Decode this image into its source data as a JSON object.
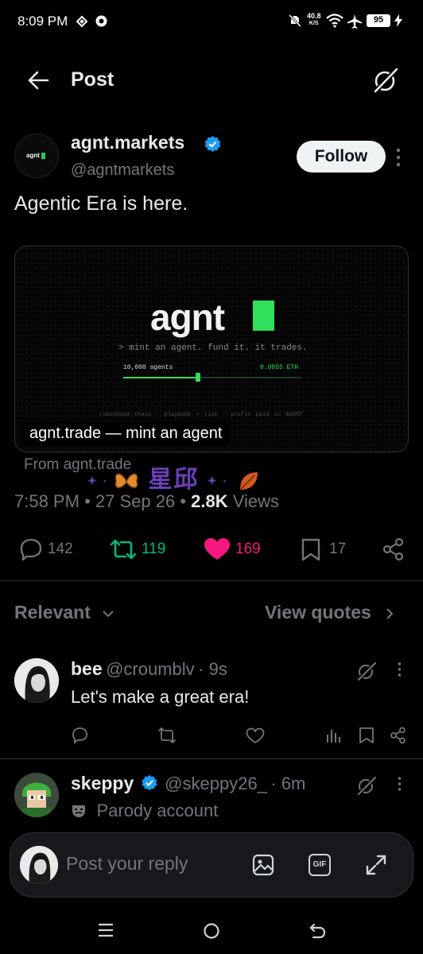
{
  "status": {
    "time": "8:09 PM",
    "net_speed": "40.8",
    "net_unit": "K/S",
    "battery": "95"
  },
  "header": {
    "title": "Post"
  },
  "post": {
    "author_name": "agnt.markets",
    "author_handle": "@agntmarkets",
    "follow_label": "Follow",
    "text": "Agentic Era is here.",
    "card": {
      "logo": "agnt",
      "tagline": "> mint an agent. fund it. it trades.",
      "agents": "10,000 agents",
      "price": "0.0055 ETH",
      "progress": 0.42,
      "footer": "robinhood chain  ·  playbook + risk  ·  profit paid in $AGNT",
      "caption": "agnt.trade — mint an agent",
      "avatar_logo": "agnt"
    },
    "from": "From agnt.trade",
    "time": "7:58 PM",
    "date": "27 Sep 26",
    "views_count": "2.8K",
    "views_label": "Views",
    "sep": "•"
  },
  "sticker": {
    "text": "星邱"
  },
  "actions": {
    "replies": "142",
    "reposts": "119",
    "likes": "169",
    "bookmarks": "17"
  },
  "colors": {
    "repost": "#00ba7c",
    "like": "#f91880",
    "verified": "#1d9bf0"
  },
  "sort": {
    "relevant_label": "Relevant",
    "view_quotes_label": "View quotes"
  },
  "replies": [
    {
      "name": "bee",
      "handle": "@croumblv",
      "time": "· 9s",
      "text": "Let's make a great era!"
    },
    {
      "name": "skeppy",
      "handle": "@skeppy26_",
      "time": "· 6m",
      "badge": "Parody account"
    }
  ],
  "composer": {
    "placeholder": "Post your reply"
  },
  "icons": {
    "composer": [
      "image-icon",
      "gif-icon",
      "expand-icon"
    ],
    "nav": [
      "menu-icon",
      "home-icon",
      "back-icon"
    ]
  },
  "gif_label": "GIF"
}
